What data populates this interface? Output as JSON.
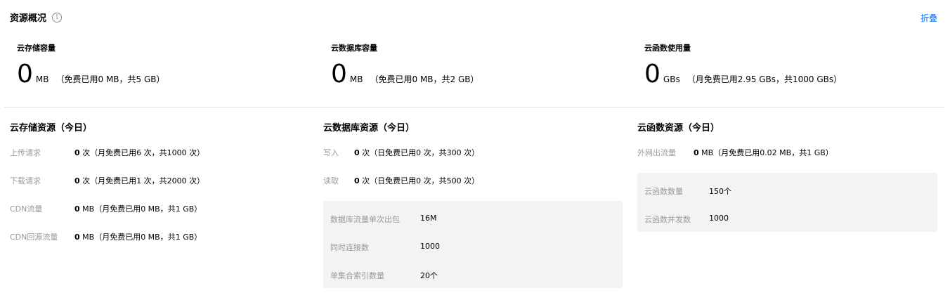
{
  "header": {
    "title": "资源概况",
    "collapse_label": "折叠"
  },
  "summary": [
    {
      "label": "云存储容量",
      "value": "0",
      "unit": "MB",
      "note": "（免费已用0 MB，共5 GB）"
    },
    {
      "label": "云数据库容量",
      "value": "0",
      "unit": "MB",
      "note": "（免费已用0 MB，共2 GB）"
    },
    {
      "label": "云函数使用量",
      "value": "0",
      "unit": "GBs",
      "note": "（月免费已用2.95 GBs，共1000 GBs）"
    }
  ],
  "storage": {
    "title": "云存储资源（今日）",
    "rows": [
      {
        "key": "上传请求",
        "bold": "0",
        "rest": " 次（月免费已用6 次，共1000 次）"
      },
      {
        "key": "下载请求",
        "bold": "0",
        "rest": " 次（月免费已用1 次，共2000 次）"
      },
      {
        "key": "CDN流量",
        "bold": "0",
        "rest": " MB（月免费已用0 MB，共1 GB）"
      },
      {
        "key": "CDN回源流量",
        "bold": "0",
        "rest": " MB（月免费已用0 MB，共1 GB）"
      }
    ]
  },
  "database": {
    "title": "云数据库资源（今日）",
    "rows": [
      {
        "key": "写入",
        "bold": "0",
        "rest": " 次（日免费已用0 次，共300 次）"
      },
      {
        "key": "读取",
        "bold": "0",
        "rest": " 次（日免费已用0 次，共500 次）"
      }
    ],
    "limits": [
      {
        "key": "数据库流量单次出包",
        "value": "16M"
      },
      {
        "key": "同时连接数",
        "value": "1000"
      },
      {
        "key": "单集合索引数量",
        "value": "20个"
      }
    ]
  },
  "functions": {
    "title": "云函数资源（今日）",
    "rows": [
      {
        "key": "外网出流量",
        "bold": "0",
        "rest": " MB（月免费已用0.02 MB，共1 GB）"
      }
    ],
    "limits": [
      {
        "key": "云函数数量",
        "value": "150个"
      },
      {
        "key": "云函数并发数",
        "value": "1000"
      }
    ]
  },
  "colors": {
    "accent": "#006eff",
    "muted": "#9a9a9a",
    "panel_bg": "#f2f3f5"
  },
  "icons": {
    "info": "info-circle-icon"
  }
}
